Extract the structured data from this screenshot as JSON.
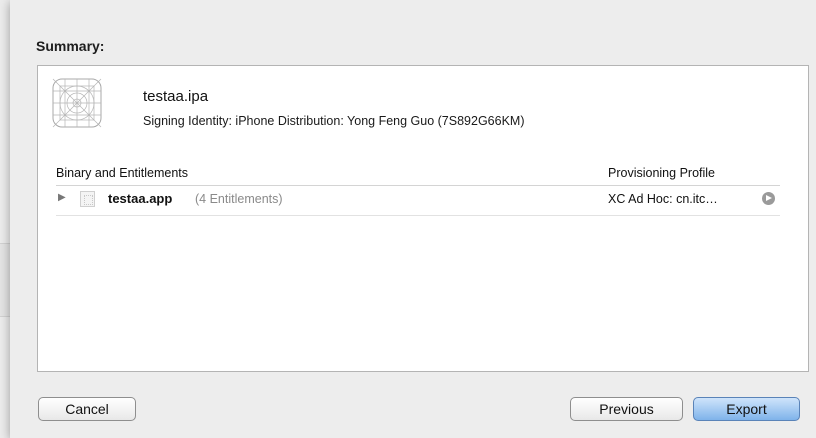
{
  "summary": {
    "title": "Summary:"
  },
  "archive": {
    "file_name": "testaa.ipa",
    "signing_identity": "Signing Identity: iPhone Distribution: Yong Feng Guo (7S892G66KM)",
    "icon": "app-placeholder-icon"
  },
  "table": {
    "columns": {
      "binary": "Binary and Entitlements",
      "profile": "Provisioning Profile"
    },
    "rows": [
      {
        "name": "testaa.app",
        "entitlements": "(4 Entitlements)",
        "profile": "XC Ad Hoc: cn.itc…",
        "disclosure": "▶",
        "icon": "file-icon",
        "action_icon": "arrow-circle-icon"
      }
    ]
  },
  "buttons": {
    "cancel": "Cancel",
    "previous": "Previous",
    "export": "Export"
  },
  "colors": {
    "export_accent": "#7fb3ea"
  }
}
